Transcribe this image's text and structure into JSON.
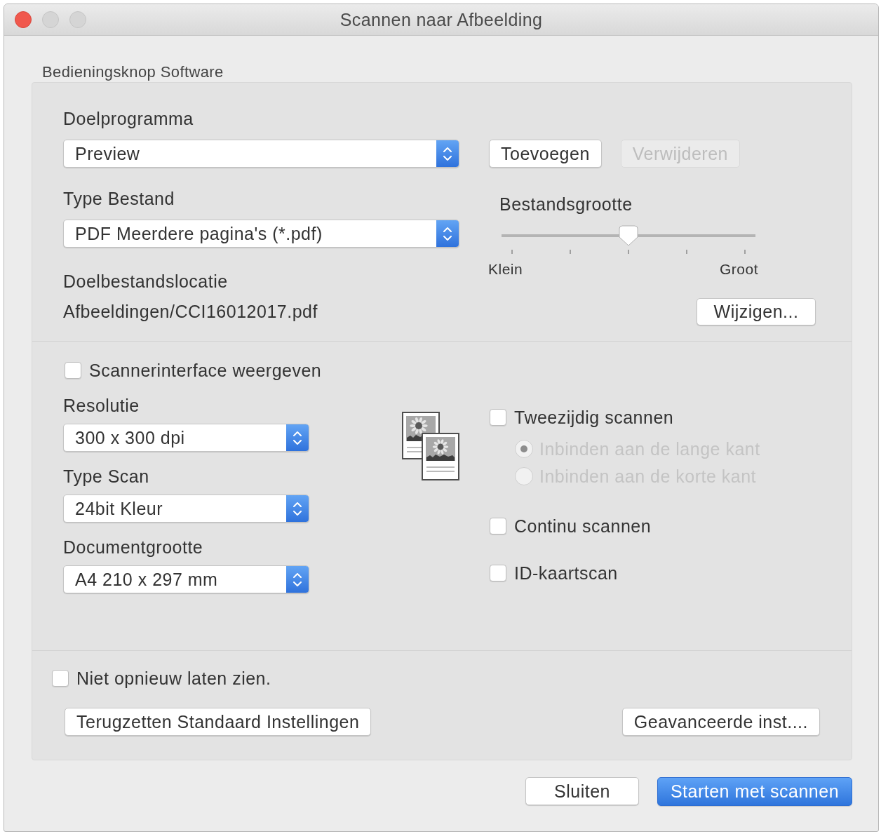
{
  "window": {
    "title": "Scannen naar Afbeelding"
  },
  "group_label": "Bedieningsknop Software",
  "target_app": {
    "label": "Doelprogramma",
    "value": "Preview"
  },
  "app_buttons": [
    {
      "label": "Toevoegen",
      "disabled": false
    },
    {
      "label": "Verwijderen",
      "disabled": true
    }
  ],
  "file_type": {
    "label": "Type Bestand",
    "value": "PDF Meerdere pagina's (*.pdf)"
  },
  "file_size": {
    "label": "Bestandsgrootte",
    "level": 0.5,
    "min_label": "Klein",
    "max_label": "Groot"
  },
  "destination": {
    "label": "Doelbestandslocatie",
    "path": "Afbeeldingen/CCI16012017.pdf",
    "button": "Wijzigen..."
  },
  "show_scanner_interface": {
    "label": "Scannerinterface weergeven",
    "checked": false
  },
  "selects": [
    {
      "label": "Resolutie",
      "value": "300 x 300 dpi"
    },
    {
      "label": "Type Scan",
      "value": "24bit Kleur"
    },
    {
      "label": "Documentgrootte",
      "value": "A4 210 x 297 mm"
    }
  ],
  "duplex": {
    "label": "Tweezijdig scannen",
    "checked": false,
    "options": [
      {
        "label": "Inbinden aan de lange kant",
        "selected": true,
        "disabled": true
      },
      {
        "label": "Inbinden aan de korte kant",
        "selected": false,
        "disabled": true
      }
    ]
  },
  "options": [
    {
      "label": "Continu scannen",
      "checked": false
    },
    {
      "label": "ID-kaartscan",
      "checked": false
    }
  ],
  "dont_show_again": {
    "label": "Niet opnieuw laten zien.",
    "checked": false
  },
  "reset_button": "Terugzetten Standaard Instellingen",
  "advanced_button": "Geavanceerde inst....",
  "footer_buttons": [
    {
      "label": "Sluiten",
      "kind": "default"
    },
    {
      "label": "Starten met scannen",
      "kind": "primary"
    }
  ]
}
